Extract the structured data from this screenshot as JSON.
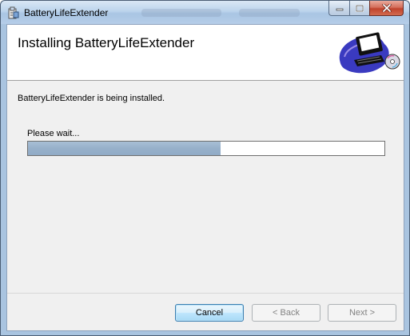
{
  "window": {
    "title": "BatteryLifeExtender",
    "icon": "installer-package-icon"
  },
  "banner": {
    "heading": "Installing BatteryLifeExtender",
    "art": "computer-with-cd-icon"
  },
  "body": {
    "status": "BatteryLifeExtender is being installed.",
    "wait": "Please wait...",
    "progress_fraction": 0.54
  },
  "buttons": {
    "cancel": "Cancel",
    "back": "< Back",
    "next": "Next >"
  },
  "colors": {
    "progress_fill": "#97b0ca",
    "close_button": "#c0432c"
  }
}
